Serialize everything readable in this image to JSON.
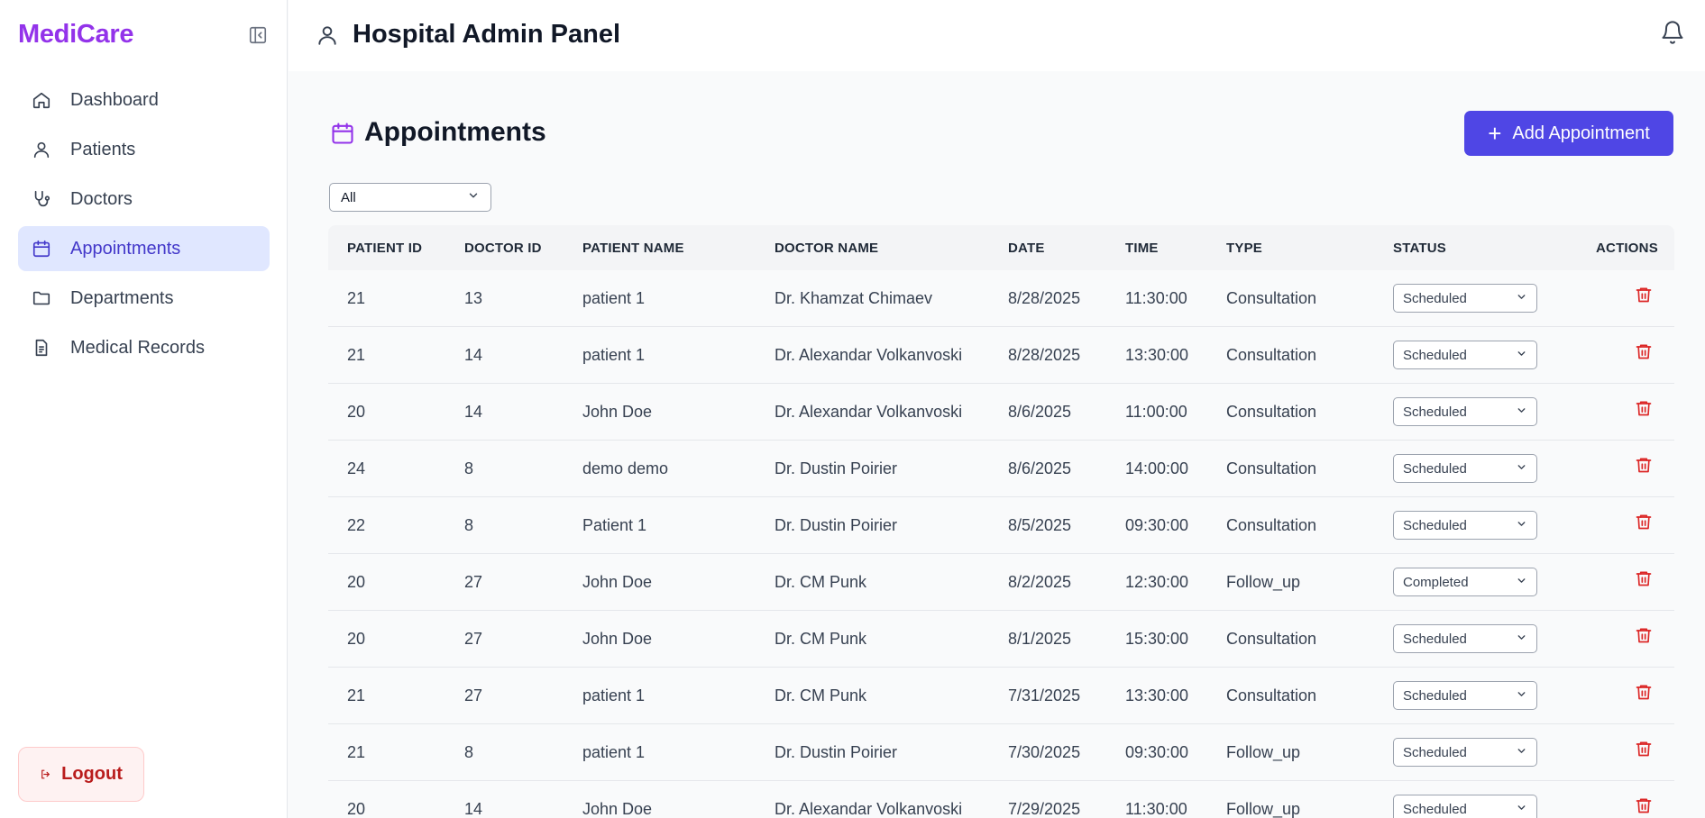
{
  "brand": "MediCare",
  "header": {
    "title": "Hospital Admin Panel"
  },
  "sidebar": {
    "items": [
      {
        "label": "Dashboard",
        "icon": "home-icon",
        "active": false
      },
      {
        "label": "Patients",
        "icon": "user-icon",
        "active": false
      },
      {
        "label": "Doctors",
        "icon": "stethoscope-icon",
        "active": false
      },
      {
        "label": "Appointments",
        "icon": "calendar-icon",
        "active": true
      },
      {
        "label": "Departments",
        "icon": "folder-icon",
        "active": false
      },
      {
        "label": "Medical Records",
        "icon": "document-icon",
        "active": false
      }
    ],
    "logout_label": "Logout"
  },
  "main": {
    "title": "Appointments",
    "add_button_label": "Add Appointment",
    "filter_value": "All"
  },
  "table": {
    "headers": [
      "PATIENT ID",
      "DOCTOR ID",
      "PATIENT NAME",
      "DOCTOR NAME",
      "DATE",
      "TIME",
      "TYPE",
      "STATUS",
      "ACTIONS"
    ],
    "rows": [
      {
        "patient_id": "21",
        "doctor_id": "13",
        "patient_name": "patient 1",
        "doctor_name": "Dr. Khamzat Chimaev",
        "date": "8/28/2025",
        "time": "11:30:00",
        "type": "Consultation",
        "status": "Scheduled"
      },
      {
        "patient_id": "21",
        "doctor_id": "14",
        "patient_name": "patient 1",
        "doctor_name": "Dr. Alexandar Volkanvoski",
        "date": "8/28/2025",
        "time": "13:30:00",
        "type": "Consultation",
        "status": "Scheduled"
      },
      {
        "patient_id": "20",
        "doctor_id": "14",
        "patient_name": "John Doe",
        "doctor_name": "Dr. Alexandar Volkanvoski",
        "date": "8/6/2025",
        "time": "11:00:00",
        "type": "Consultation",
        "status": "Scheduled"
      },
      {
        "patient_id": "24",
        "doctor_id": "8",
        "patient_name": "demo demo",
        "doctor_name": "Dr. Dustin Poirier",
        "date": "8/6/2025",
        "time": "14:00:00",
        "type": "Consultation",
        "status": "Scheduled"
      },
      {
        "patient_id": "22",
        "doctor_id": "8",
        "patient_name": "Patient 1",
        "doctor_name": "Dr. Dustin Poirier",
        "date": "8/5/2025",
        "time": "09:30:00",
        "type": "Consultation",
        "status": "Scheduled"
      },
      {
        "patient_id": "20",
        "doctor_id": "27",
        "patient_name": "John Doe",
        "doctor_name": "Dr. CM Punk",
        "date": "8/2/2025",
        "time": "12:30:00",
        "type": "Follow_up",
        "status": "Completed"
      },
      {
        "patient_id": "20",
        "doctor_id": "27",
        "patient_name": "John Doe",
        "doctor_name": "Dr. CM Punk",
        "date": "8/1/2025",
        "time": "15:30:00",
        "type": "Consultation",
        "status": "Scheduled"
      },
      {
        "patient_id": "21",
        "doctor_id": "27",
        "patient_name": "patient 1",
        "doctor_name": "Dr. CM Punk",
        "date": "7/31/2025",
        "time": "13:30:00",
        "type": "Consultation",
        "status": "Scheduled"
      },
      {
        "patient_id": "21",
        "doctor_id": "8",
        "patient_name": "patient 1",
        "doctor_name": "Dr. Dustin Poirier",
        "date": "7/30/2025",
        "time": "09:30:00",
        "type": "Follow_up",
        "status": "Scheduled"
      },
      {
        "patient_id": "20",
        "doctor_id": "14",
        "patient_name": "John Doe",
        "doctor_name": "Dr. Alexandar Volkanvoski",
        "date": "7/29/2025",
        "time": "11:30:00",
        "type": "Follow_up",
        "status": "Scheduled"
      }
    ]
  },
  "colors": {
    "brand": "#9333ea",
    "accent": "#4f46e5",
    "danger": "#dc2626",
    "active_bg": "#e0e7ff"
  }
}
